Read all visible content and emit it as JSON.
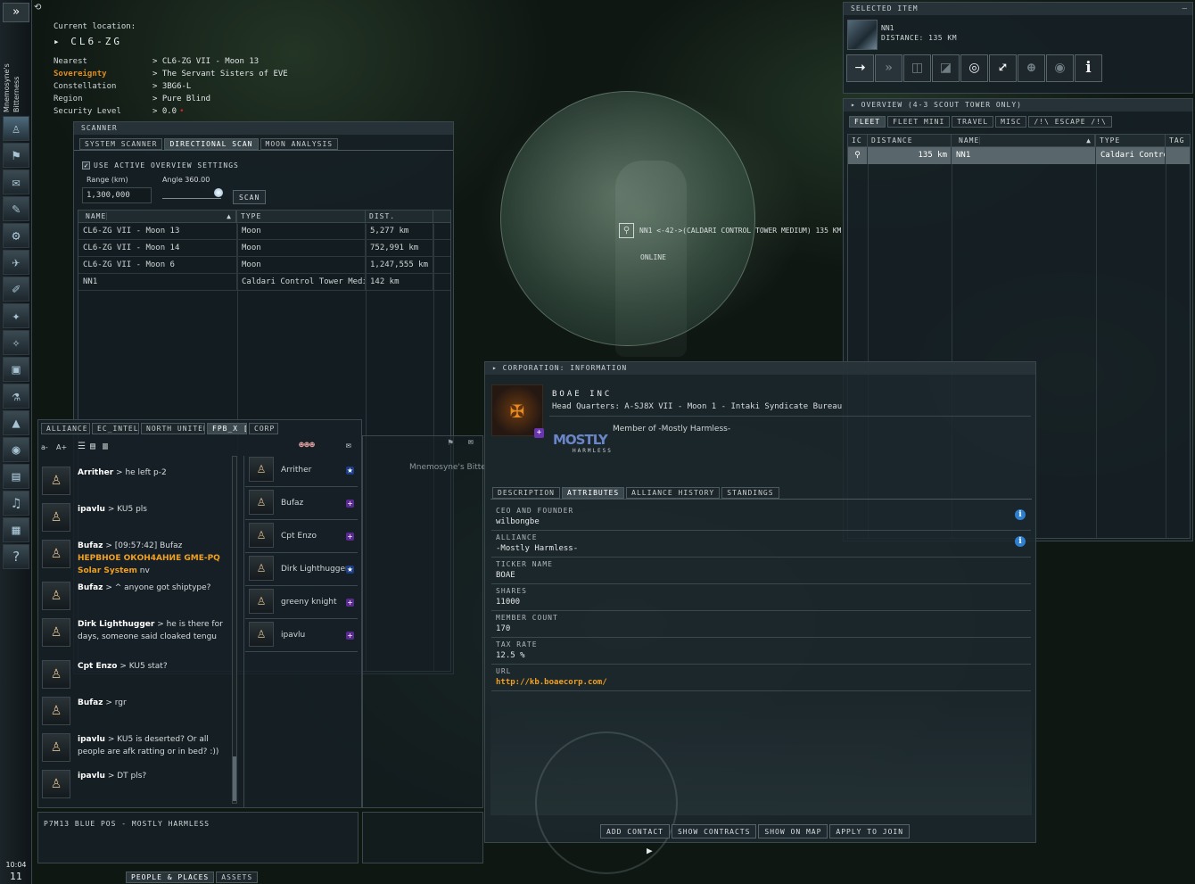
{
  "location": {
    "label": "Current location:",
    "system": "CL6-ZG",
    "rows": [
      {
        "k": "Nearest",
        "v": "CL6-ZG VII - Moon 13"
      },
      {
        "k": "Sovereignty",
        "v": "The Servant Sisters of EVE"
      },
      {
        "k": "Constellation",
        "v": "3BG6-L"
      },
      {
        "k": "Region",
        "v": "Pure Blind"
      },
      {
        "k": "Security Level",
        "v": "0.0"
      }
    ]
  },
  "sidebar": {
    "caption": "Mnemosyne's Bitterness",
    "expand": "»",
    "clock": "10:04",
    "clock2": "11"
  },
  "scanner": {
    "title": "SCANNER",
    "tabs": [
      "SYSTEM SCANNER",
      "DIRECTIONAL SCAN",
      "MOON ANALYSIS"
    ],
    "use_overview": "USE ACTIVE OVERVIEW SETTINGS",
    "range_label": "Range (km)",
    "range_value": "1,300,000",
    "angle_label": "Angle 360.00",
    "scan_btn": "SCAN",
    "columns": [
      "NAME",
      "TYPE",
      "DIST."
    ],
    "rows": [
      [
        "CL6-ZG VII - Moon 13",
        "Moon",
        "5,277 km"
      ],
      [
        "CL6-ZG VII - Moon 14",
        "Moon",
        "752,991 km"
      ],
      [
        "CL6-ZG VII - Moon 6",
        "Moon",
        "1,247,555 km"
      ],
      [
        "NN1",
        "Caldari Control Tower Medium",
        "142 km"
      ]
    ]
  },
  "selected": {
    "title": "SELECTED ITEM",
    "name": "NN1",
    "distance": "DISTANCE: 135 KM",
    "actions": [
      "approach-icon",
      "warp-icon",
      "jump-icon",
      "dock-icon",
      "orbit-icon",
      "keep-range-icon",
      "lock-target-icon",
      "look-at-icon",
      "info-icon"
    ]
  },
  "overview": {
    "title": "OVERVIEW (4-3 SCOUT TOWER ONLY)",
    "tabs": [
      "FLEET",
      "FLEET MINI",
      "TRAVEL",
      "MISC",
      "/!\\ ESCAPE /!\\"
    ],
    "columns": [
      "IC",
      "DISTANCE",
      "NAME",
      "TYPE",
      "TAG"
    ],
    "row": {
      "distance": "135 km",
      "name": "NN1",
      "type": "Caldari Control"
    }
  },
  "space": {
    "bracket": "NN1 <-42->(CALDARI CONTROL TOWER MEDIUM) 135 KM",
    "status": "ONLINE"
  },
  "chat": {
    "tabs": [
      "ALLIANCE",
      "EC_INTEL",
      "NORTH UNITED",
      "FPB_X [",
      "CORP"
    ],
    "font_small": "a-",
    "font_large": "A+",
    "messages": [
      {
        "name": "Arrither",
        "text": " > he left p-2"
      },
      {
        "name": "ipavlu",
        "text": " > KU5 pls"
      },
      {
        "name": "Bufaz",
        "text": " > [09:57:42] Bufaz",
        "link": "НЕРВНОЕ ОКОН4АНИЕ  GME-PQ Solar System",
        "tail": " nv"
      },
      {
        "name": "Bufaz",
        "text": " > ^ anyone got shiptype?"
      },
      {
        "name": "Dirk Lighthugger",
        "text": " > he is there for days, someone said cloaked tengu"
      },
      {
        "name": "Cpt Enzo",
        "text": " > KU5 stat?"
      },
      {
        "name": "Bufaz",
        "text": " > rgr"
      },
      {
        "name": "ipavlu",
        "text": " > KU5 is deserted? Or all people are afk ratting or in bed? :))"
      },
      {
        "name": "ipavlu",
        "text": " > DT pls?"
      }
    ],
    "members": [
      {
        "name": "Arrither",
        "badge": "★"
      },
      {
        "name": "Bufaz",
        "badge": "+"
      },
      {
        "name": "Cpt Enzo",
        "badge": "+"
      },
      {
        "name": "Dirk Lighthugger",
        "badge": "★"
      },
      {
        "name": "greeny knight",
        "badge": "+"
      },
      {
        "name": "ipavlu",
        "badge": "+"
      }
    ],
    "motd": "P7M13 BLUE POS - MOSTLY HARMLESS",
    "ghost_caption": "Mnemosyne's Bitte"
  },
  "corp": {
    "title": "CORPORATION: INFORMATION",
    "name": "BOAE INC",
    "hq": "Head Quarters: A-SJ8X VII - Moon 1 - Intaki Syndicate Bureau",
    "member_of": "Member of -Mostly Harmless-",
    "alliance_logo": "MOSTLY",
    "alliance_logo_sub": "HARMLESS",
    "tabs": [
      "DESCRIPTION",
      "ATTRIBUTES",
      "ALLIANCE HISTORY",
      "STANDINGS"
    ],
    "attrs": [
      {
        "l": "CEO AND FOUNDER",
        "v": "wilbongbe",
        "info": true
      },
      {
        "l": "ALLIANCE",
        "v": "-Mostly Harmless-",
        "info": true
      },
      {
        "l": "TICKER NAME",
        "v": "BOAE"
      },
      {
        "l": "SHARES",
        "v": "11000"
      },
      {
        "l": "MEMBER COUNT",
        "v": "170"
      },
      {
        "l": "TAX RATE",
        "v": "12.5 %"
      },
      {
        "l": "URL",
        "v": "http://kb.boaecorp.com/"
      }
    ],
    "buttons": [
      "ADD CONTACT",
      "SHOW CONTRACTS",
      "SHOW ON MAP",
      "APPLY TO JOIN"
    ]
  },
  "bottom_tabs": [
    "PEOPLE & PLACES",
    "ASSETS"
  ],
  "colors": {
    "accent": "#f0a020",
    "link": "#f0a020",
    "sov": "#e08c20",
    "info": "#2f7fd0"
  }
}
